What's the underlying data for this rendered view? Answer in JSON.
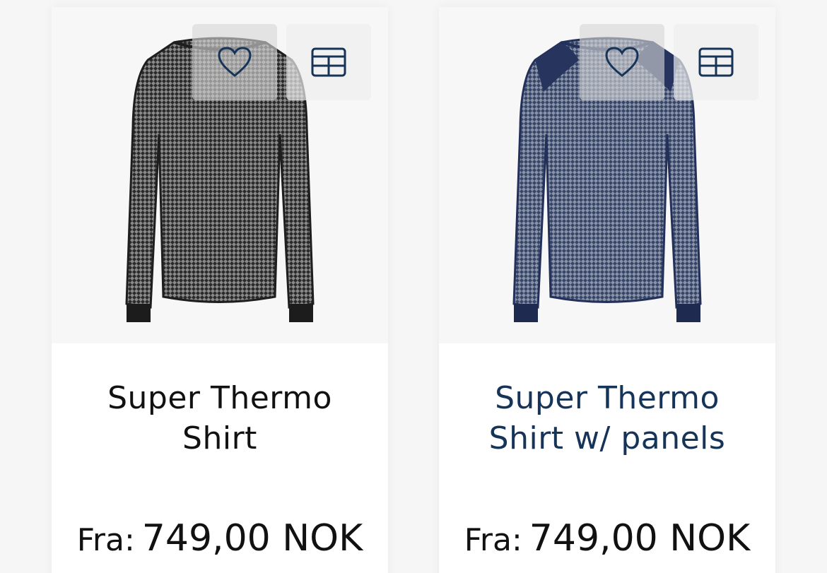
{
  "products": [
    {
      "title_line1": "Super Thermo",
      "title_line2": "Shirt",
      "price_prefix": "Fra:",
      "price_value": "749,00 NOK",
      "shirt_color": "#2e2e30",
      "title_color": "#111111",
      "favorite_icon": "heart-icon",
      "compare_icon": "compare-table-icon"
    },
    {
      "title_line1": "Super Thermo",
      "title_line2": "Shirt w/ panels",
      "price_prefix": "Fra:",
      "price_value": "749,00 NOK",
      "shirt_color": "#2f3f66",
      "title_color": "#163358",
      "favorite_icon": "heart-icon",
      "compare_icon": "compare-table-icon"
    }
  ],
  "accent_color": "#163358"
}
